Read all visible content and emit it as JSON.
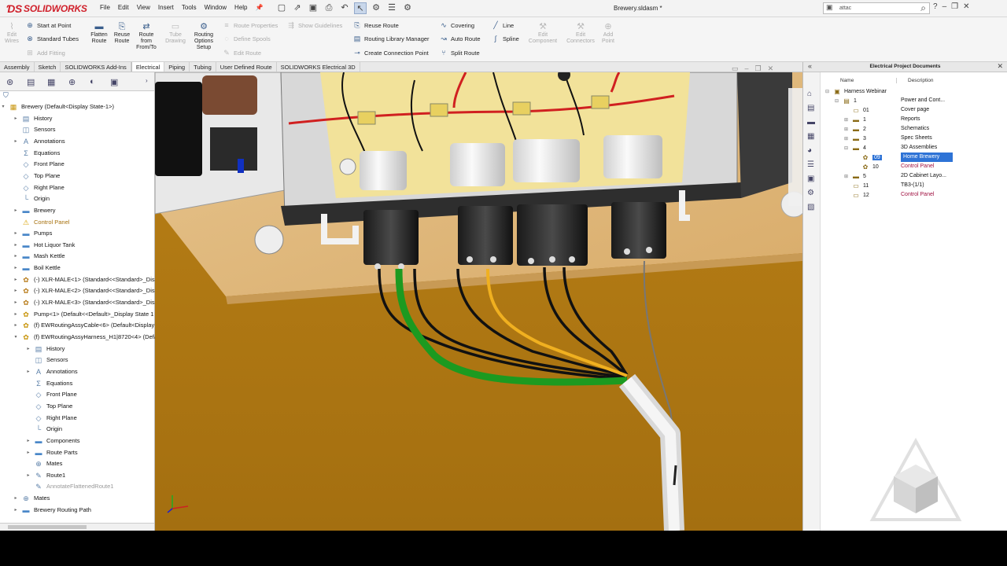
{
  "app": {
    "logo_text": "SOLIDWORKS",
    "document_title": "Brewery.sldasm *",
    "search_value": "attac"
  },
  "menu": [
    "File",
    "Edit",
    "View",
    "Insert",
    "Tools",
    "Window",
    "Help"
  ],
  "ribbon": {
    "edit_wires": "Edit Wires",
    "start_at_point": "Start at Point",
    "standard_tubes": "Standard Tubes",
    "add_fitting": "Add Fitting",
    "flatten_route": "Flatten Route",
    "reuse_route_big": "Reuse Route",
    "route_from_to": "Route from From/To",
    "tube_drawing": "Tube Drawing",
    "routing_options": "Routing Options Setup",
    "route_properties": "Route Properties",
    "show_guidelines": "Show Guidelines",
    "define_spools": "Define Spools",
    "edit_route": "Edit Route",
    "reuse_route": "Reuse Route",
    "routing_library": "Routing Library Manager",
    "create_connection": "Create Connection Point",
    "covering": "Covering",
    "auto_route": "Auto Route",
    "split_route": "Split Route",
    "line": "Line",
    "spline": "Spline",
    "edit_component": "Edit Component",
    "edit_connectors": "Edit Connectors",
    "add_point": "Add Point"
  },
  "tabs": [
    "Assembly",
    "Sketch",
    "SOLIDWORKS Add-Ins",
    "Electrical",
    "Piping",
    "Tubing",
    "User Defined Route",
    "SOLIDWORKS Electrical 3D"
  ],
  "active_tab": "Electrical",
  "tree": [
    {
      "label": "Brewery  (Default<Display State-1>)",
      "indent": 0,
      "icon": "assembly-icon",
      "glyph": "▦",
      "arrow": "▾"
    },
    {
      "label": "History",
      "indent": 1,
      "icon": "history-icon",
      "glyph": "▤",
      "arrow": "▸"
    },
    {
      "label": "Sensors",
      "indent": 1,
      "icon": "sensors-icon",
      "glyph": "◫",
      "arrow": ""
    },
    {
      "label": "Annotations",
      "indent": 1,
      "icon": "annotations-icon",
      "glyph": "A",
      "arrow": "▸"
    },
    {
      "label": "Equations",
      "indent": 1,
      "icon": "equations-icon",
      "glyph": "Σ",
      "arrow": ""
    },
    {
      "label": "Front Plane",
      "indent": 1,
      "icon": "plane-icon",
      "glyph": "◇",
      "arrow": ""
    },
    {
      "label": "Top Plane",
      "indent": 1,
      "icon": "plane-icon",
      "glyph": "◇",
      "arrow": ""
    },
    {
      "label": "Right Plane",
      "indent": 1,
      "icon": "plane-icon",
      "glyph": "◇",
      "arrow": ""
    },
    {
      "label": "Origin",
      "indent": 1,
      "icon": "origin-icon",
      "glyph": "└",
      "arrow": ""
    },
    {
      "label": "Brewery",
      "indent": 1,
      "icon": "folder-icon",
      "glyph": "▬",
      "arrow": "▸"
    },
    {
      "label": "Control Panel",
      "indent": 1,
      "icon": "warning-icon",
      "glyph": "⚠",
      "arrow": "",
      "warn": true
    },
    {
      "label": "Pumps",
      "indent": 1,
      "icon": "folder-icon",
      "glyph": "▬",
      "arrow": "▸"
    },
    {
      "label": "Hot Liquor Tank",
      "indent": 1,
      "icon": "folder-icon",
      "glyph": "▬",
      "arrow": "▸"
    },
    {
      "label": "Mash Kettle",
      "indent": 1,
      "icon": "folder-icon",
      "glyph": "▬",
      "arrow": "▸"
    },
    {
      "label": "Boil Kettle",
      "indent": 1,
      "icon": "folder-icon",
      "glyph": "▬",
      "arrow": "▸"
    },
    {
      "label": "(-) XLR-MALE<1> (Standard<<Standard>_Disp",
      "indent": 1,
      "icon": "part-icon",
      "glyph": "✿",
      "arrow": "▸"
    },
    {
      "label": "(-) XLR-MALE<2> (Standard<<Standard>_Disp",
      "indent": 1,
      "icon": "part-icon",
      "glyph": "✿",
      "arrow": "▸"
    },
    {
      "label": "(-) XLR-MALE<3> (Standard<<Standard>_Disp",
      "indent": 1,
      "icon": "part-icon",
      "glyph": "✿",
      "arrow": "▸"
    },
    {
      "label": "Pump<1> (Default<<Default>_Display State 1",
      "indent": 1,
      "icon": "assembly-icon",
      "glyph": "✿",
      "arrow": "▸"
    },
    {
      "label": "(f) EWRoutingAssyCable<6> (Default<Display",
      "indent": 1,
      "icon": "assembly-icon",
      "glyph": "✿",
      "arrow": "▸"
    },
    {
      "label": "(f) EWRoutingAssyHarness_H1|8720<4> (Defau",
      "indent": 1,
      "icon": "assembly-icon",
      "glyph": "✿",
      "arrow": "▾"
    },
    {
      "label": "History",
      "indent": 2,
      "icon": "history-icon",
      "glyph": "▤",
      "arrow": "▸"
    },
    {
      "label": "Sensors",
      "indent": 2,
      "icon": "sensors-icon",
      "glyph": "◫",
      "arrow": ""
    },
    {
      "label": "Annotations",
      "indent": 2,
      "icon": "annotations-icon",
      "glyph": "A",
      "arrow": "▸"
    },
    {
      "label": "Equations",
      "indent": 2,
      "icon": "equations-icon",
      "glyph": "Σ",
      "arrow": ""
    },
    {
      "label": "Front Plane",
      "indent": 2,
      "icon": "plane-icon",
      "glyph": "◇",
      "arrow": ""
    },
    {
      "label": "Top Plane",
      "indent": 2,
      "icon": "plane-icon",
      "glyph": "◇",
      "arrow": ""
    },
    {
      "label": "Right Plane",
      "indent": 2,
      "icon": "plane-icon",
      "glyph": "◇",
      "arrow": ""
    },
    {
      "label": "Origin",
      "indent": 2,
      "icon": "origin-icon",
      "glyph": "└",
      "arrow": ""
    },
    {
      "label": "Components",
      "indent": 2,
      "icon": "folder-icon",
      "glyph": "▬",
      "arrow": "▸"
    },
    {
      "label": "Route Parts",
      "indent": 2,
      "icon": "folder-icon",
      "glyph": "▬",
      "arrow": "▸"
    },
    {
      "label": "Mates",
      "indent": 2,
      "icon": "mates-icon",
      "glyph": "⊕",
      "arrow": ""
    },
    {
      "label": "Route1",
      "indent": 2,
      "icon": "route-icon",
      "glyph": "✎",
      "arrow": "▸"
    },
    {
      "label": "AnnotateFlattenedRoute1",
      "indent": 2,
      "icon": "route-icon",
      "glyph": "✎",
      "arrow": "",
      "gray": true
    },
    {
      "label": "Mates",
      "indent": 1,
      "icon": "mates-icon",
      "glyph": "⊕",
      "arrow": "▸"
    },
    {
      "label": "Brewery Routing Path",
      "indent": 1,
      "icon": "folder-icon",
      "glyph": "▬",
      "arrow": "▸"
    }
  ],
  "project_panel": {
    "title": "Electrical Project Documents",
    "col_name": "Name",
    "col_desc": "Description",
    "rows": [
      {
        "name": "Harness Webinar",
        "desc": "",
        "indent": 0,
        "exp": "⊟",
        "icon": "project-icon",
        "glyph": "▣"
      },
      {
        "name": "1",
        "desc": "Power and Cont...",
        "indent": 1,
        "exp": "⊟",
        "icon": "book-icon",
        "glyph": "▤"
      },
      {
        "name": "01",
        "desc": "Cover page",
        "indent": 2,
        "exp": "",
        "icon": "page-icon",
        "glyph": "▭"
      },
      {
        "name": "1",
        "desc": "Reports",
        "indent": 2,
        "exp": "⊞",
        "icon": "folder-icon",
        "glyph": "▬"
      },
      {
        "name": "2",
        "desc": "Schematics",
        "indent": 2,
        "exp": "⊞",
        "icon": "folder-icon",
        "glyph": "▬"
      },
      {
        "name": "3",
        "desc": "Spec Sheets",
        "indent": 2,
        "exp": "⊞",
        "icon": "folder-icon",
        "glyph": "▬"
      },
      {
        "name": "4",
        "desc": "3D Assemblies",
        "indent": 2,
        "exp": "⊟",
        "icon": "folder-icon",
        "glyph": "▬"
      },
      {
        "name": "09",
        "desc": "Home Brewery",
        "indent": 3,
        "exp": "",
        "icon": "assembly-icon",
        "glyph": "✿",
        "selected": true
      },
      {
        "name": "10",
        "desc": "Control Panel",
        "indent": 3,
        "exp": "",
        "icon": "assembly-icon",
        "glyph": "✿",
        "pink": true
      },
      {
        "name": "5",
        "desc": "2D Cabinet Layo...",
        "indent": 2,
        "exp": "⊞",
        "icon": "folder-icon",
        "glyph": "▬"
      },
      {
        "name": "11",
        "desc": "TB3-(1/1)",
        "indent": 2,
        "exp": "",
        "icon": "page-icon",
        "glyph": "▭"
      },
      {
        "name": "12",
        "desc": "Control Panel",
        "indent": 2,
        "exp": "",
        "icon": "page-icon",
        "glyph": "▭",
        "pink": true
      }
    ]
  },
  "colors": {
    "accent_selection": "#2e73d6",
    "brand_red": "#d0202b",
    "floor": "#b57a14",
    "harness_green": "#1c9a20",
    "wire_yellow": "#f0b020"
  }
}
